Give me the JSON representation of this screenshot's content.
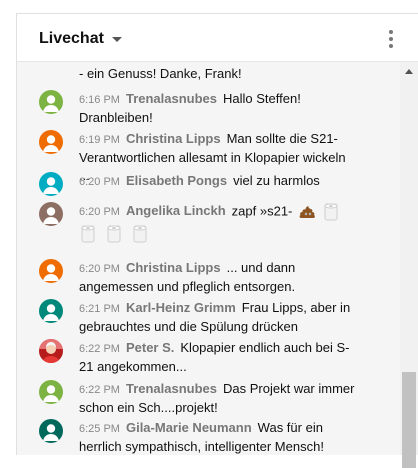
{
  "header": {
    "title": "Livechat"
  },
  "partial_message": "- ein Genuss! Danke, Frank!",
  "messages": [
    {
      "time": "6:16 PM",
      "author": "Trenalasnubes",
      "text": "Hallo Steffen! Dranbleiben!",
      "avatar_color": "#7cb342",
      "avatar_icon": "person-silhouette-icon"
    },
    {
      "time": "6:19 PM",
      "author": "Christina Lipps",
      "text": "Man sollte die S21-Verantwortlichen allesamt in Klopapier wickeln ...",
      "avatar_color": "#ef6c00",
      "avatar_icon": "person-silhouette-icon"
    },
    {
      "time": "6:20 PM",
      "author": "Elisabeth Pongs",
      "text": "viel zu harmlos",
      "avatar_color": "#00acc1",
      "avatar_icon": "person-silhouette-icon"
    },
    {
      "time": "6:20 PM",
      "author": "Angelika Linckh",
      "text": "zapf »s21-",
      "avatar_color": "#8d6e63",
      "avatar_icon": "person-silhouette-icon",
      "emojis": [
        "pile-of-poo-emoji",
        "toilet-paper-emoji",
        "toilet-paper-emoji",
        "toilet-paper-emoji",
        "toilet-paper-emoji"
      ]
    },
    {
      "time": "6:20 PM",
      "author": "Christina Lipps",
      "text": "... und dann angemessen und pfleglich entsorgen.",
      "avatar_color": "#ef6c00",
      "avatar_icon": "person-silhouette-icon"
    },
    {
      "time": "6:21 PM",
      "author": "Karl-Heinz Grimm",
      "text": "Frau Lipps, aber in gebrauchtes und die Spülung drücken",
      "avatar_color": "#00897b",
      "avatar_icon": "person-silhouette-icon"
    },
    {
      "time": "6:22 PM",
      "author": "Peter S.",
      "text": "Klopapier endlich auch bei S-21 angekommen...",
      "avatar_color": "#c62828",
      "avatar_icon": "user-photo"
    },
    {
      "time": "6:22 PM",
      "author": "Trenalasnubes",
      "text": "Das Projekt war immer schon ein Sch....projekt!",
      "avatar_color": "#7cb342",
      "avatar_icon": "person-silhouette-icon"
    },
    {
      "time": "6:25 PM",
      "author": "Gila-Marie Neumann",
      "text": "Was für ein herrlich sympathisch, intelligenter Mensch!",
      "avatar_color": "#00695c",
      "avatar_icon": "person-silhouette-icon"
    }
  ]
}
